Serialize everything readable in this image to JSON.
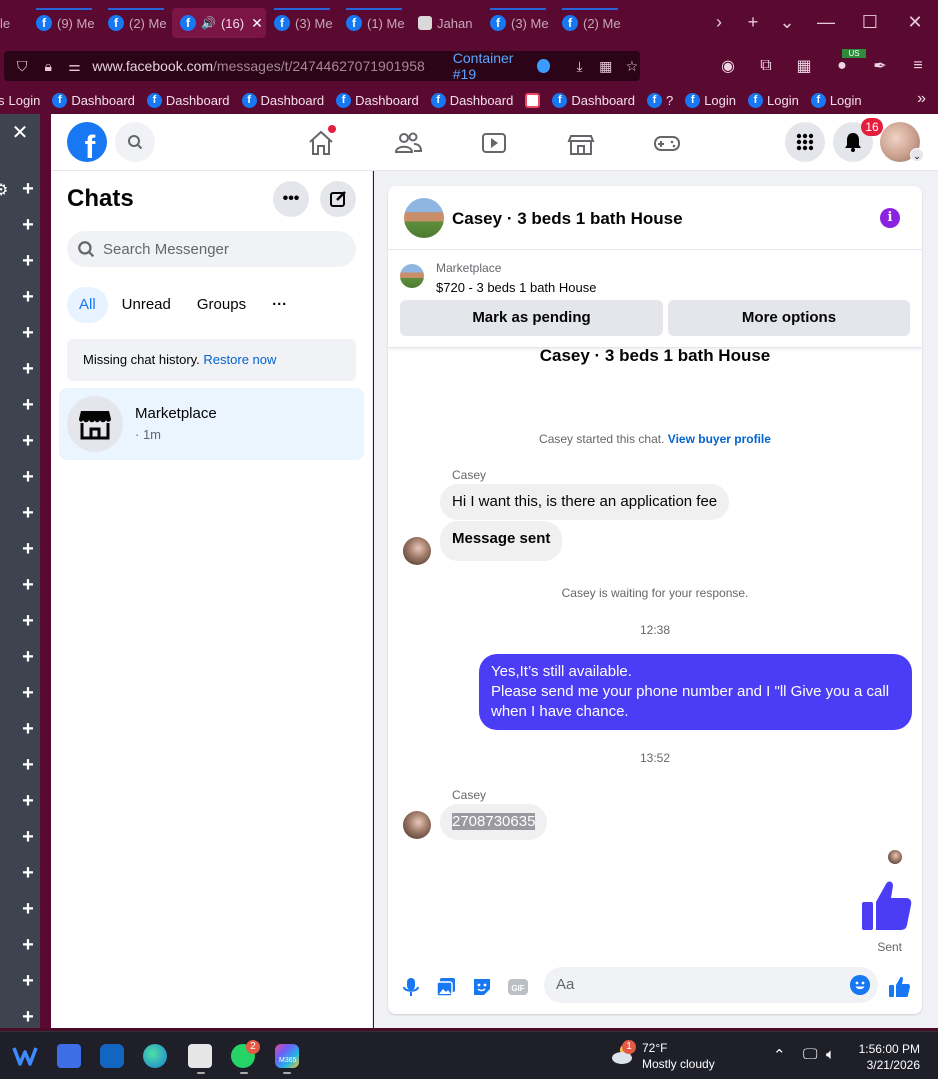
{
  "browser": {
    "tabs": [
      {
        "label": "(9) Me",
        "type": "fb"
      },
      {
        "label": "(2) Me",
        "type": "fb"
      },
      {
        "label": "(16)",
        "type": "fb",
        "active": true
      },
      {
        "label": "(3) Me",
        "type": "fb"
      },
      {
        "label": "(1) Me",
        "type": "fb"
      },
      {
        "label": "Jahan",
        "type": "mail"
      },
      {
        "label": "(3) Me",
        "type": "fb"
      },
      {
        "label": "(2) Me",
        "type": "fb"
      }
    ],
    "first_tab_fragment": "le",
    "url_domain": "www.facebook.com",
    "url_path": "/messages/t/24744627071901958",
    "container_label": "Container #19",
    "bookmarks": [
      {
        "label": "Login",
        "type": "fb"
      },
      {
        "label": "Dashboard",
        "type": "fb"
      },
      {
        "label": "Dashboard",
        "type": "fb"
      },
      {
        "label": "Dashboard",
        "type": "fb"
      },
      {
        "label": "Dashboard",
        "type": "fb"
      },
      {
        "label": "Dashboard",
        "type": "fb"
      },
      {
        "label": "",
        "type": "cam"
      },
      {
        "label": "Dashboard",
        "type": "fb"
      },
      {
        "label": "?",
        "type": "fb"
      },
      {
        "label": "Login",
        "type": "fb"
      },
      {
        "label": "Login",
        "type": "fb"
      },
      {
        "label": "Login",
        "type": "fb"
      }
    ],
    "us_badge": "US"
  },
  "facebook": {
    "notification_count": "16"
  },
  "chats": {
    "title": "Chats",
    "search_placeholder": "Search Messenger",
    "filters": [
      "All",
      "Unread",
      "Groups"
    ],
    "missing_text": "Missing chat history. ",
    "restore_link": "Restore now",
    "conversation": {
      "name": "Marketplace",
      "time": "· 1m"
    }
  },
  "conversation": {
    "title": "Casey · 3 beds 1 bath House",
    "marketplace_label": "Marketplace",
    "listing": "$720 - 3 beds 1 bath House",
    "mark_pending": "Mark as pending",
    "more_options": "More options",
    "subtitle": "Casey · 3 beds 1 bath House",
    "started_text": "Casey started this chat. ",
    "view_buyer": "View buyer profile",
    "sender_name": "Casey",
    "msg1": "Hi I want this, is there an application fee",
    "msg2": "Message sent",
    "waiting": "Casey is waiting for your response.",
    "time1": "12:38",
    "reply_line1": "Yes,It’s still available.",
    "reply_line2": "Please send me your phone number and I \"ll Give you a call when I have chance.",
    "time2": "13:52",
    "phone": "2708730635",
    "sent_label": "Sent",
    "input_placeholder": "Aa",
    "accent": "#4b3cf5"
  },
  "taskbar": {
    "temp": "72°F",
    "weather": "Mostly cloudy",
    "time": "1:56:00 PM",
    "date": "3/21/2026",
    "weather_badge": "1",
    "whatsapp_badge": "2",
    "m365": "M365"
  }
}
